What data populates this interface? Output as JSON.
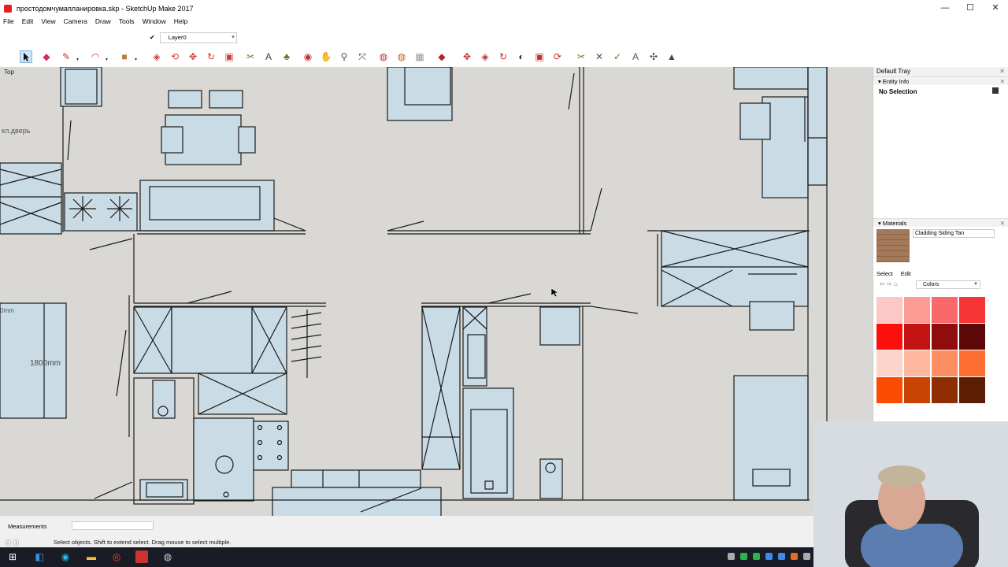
{
  "window": {
    "title": "простодомчумапланировка.skp - SketchUp Make 2017",
    "controls": {
      "minimize": "—",
      "maximize": "☐",
      "close": "✕"
    }
  },
  "menu": [
    "File",
    "Edit",
    "View",
    "Camera",
    "Draw",
    "Tools",
    "Window",
    "Help"
  ],
  "layer": {
    "current": "Layer0"
  },
  "canvas": {
    "view_label": "Top",
    "annotations": {
      "door_label": "кл.дверь",
      "dim_left": "0mm",
      "dim_1800": "1800mm"
    }
  },
  "tray": {
    "title": "Default Tray",
    "entity_info": {
      "title": "Entity Info",
      "selection": "No Selection"
    },
    "materials": {
      "title": "Materials",
      "current_material": "Cladding Siding Tan",
      "tab_select": "Select",
      "tab_edit": "Edit",
      "collection": "Colors",
      "swatch_colors": [
        "#fcc7c4",
        "#fc9c95",
        "#f9686a",
        "#f53435",
        "#fd0f0e",
        "#c41313",
        "#8f0d0d",
        "#5c0808",
        "#fdd4c9",
        "#fdb89e",
        "#fc8f62",
        "#fb6d31",
        "#fc4c04",
        "#c94303",
        "#8e2e02",
        "#5b1e02"
      ]
    }
  },
  "status": {
    "measurements_label": "Measurements",
    "hint": "Select objects. Shift to extend select. Drag mouse to select multiple."
  },
  "colors": {
    "canvas_bg": "#d9d8d5",
    "furniture_fill": "#c9dbe5",
    "taskbar_bg": "#1a1c25"
  }
}
